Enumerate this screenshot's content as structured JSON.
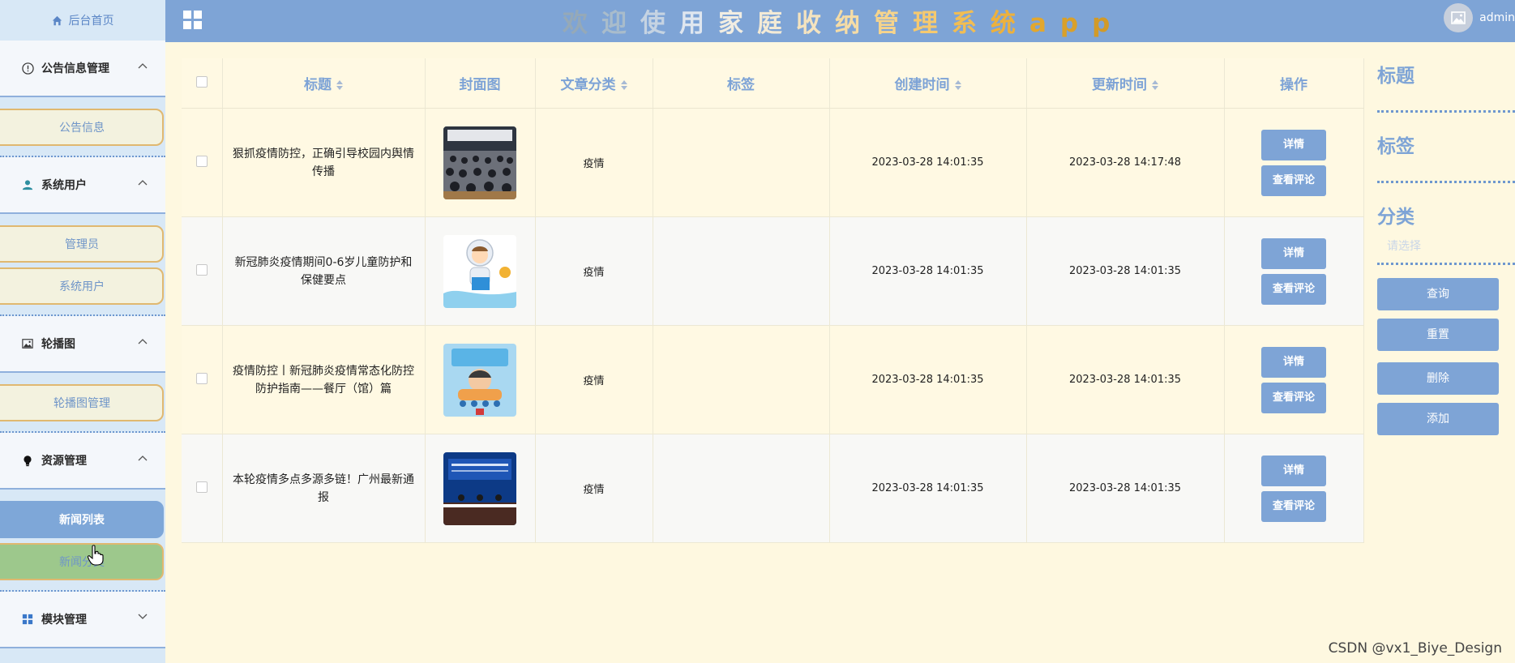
{
  "header": {
    "title_chars": [
      {
        "ch": "欢",
        "color": "#95a9b8"
      },
      {
        "ch": "迎",
        "color": "#a9bccb"
      },
      {
        "ch": "使",
        "color": "#c5d3e2"
      },
      {
        "ch": "用",
        "color": "#dfe6ef"
      },
      {
        "ch": "家",
        "color": "#f1ede2"
      },
      {
        "ch": "庭",
        "color": "#f3ead6"
      },
      {
        "ch": "收",
        "color": "#f4e3bf"
      },
      {
        "ch": "纳",
        "color": "#f5dca6"
      },
      {
        "ch": "管",
        "color": "#f6d48c"
      },
      {
        "ch": "理",
        "color": "#f5c96f"
      },
      {
        "ch": "系",
        "color": "#f2bd52"
      },
      {
        "ch": "统",
        "color": "#edb13c"
      },
      {
        "ch": "a",
        "color": "#e2a72e"
      },
      {
        "ch": "p",
        "color": "#d9a02a"
      },
      {
        "ch": "p",
        "color": "#d29a28"
      }
    ],
    "user_name": "admin"
  },
  "sidebar": {
    "home": "后台首页",
    "groups": [
      {
        "label": "公告信息管理",
        "icon": "info-icon",
        "items": [
          "公告信息"
        ]
      },
      {
        "label": "系统用户",
        "icon": "user-icon",
        "items": [
          "管理员",
          "系统用户"
        ]
      },
      {
        "label": "轮播图",
        "icon": "picture-icon",
        "items": [
          "轮播图管理"
        ]
      },
      {
        "label": "资源管理",
        "icon": "bulb-icon",
        "items": [
          "新闻列表",
          "新闻分类列表"
        ]
      },
      {
        "label": "模块管理",
        "icon": "grid-icon",
        "items": []
      }
    ],
    "hover_item_text": "新闻分类"
  },
  "table": {
    "headers": [
      "标题",
      "封面图",
      "文章分类",
      "标签",
      "创建时间",
      "更新时间",
      "操作"
    ],
    "rows": [
      {
        "title": "狠抓疫情防控，正确引导校园内舆情传播",
        "category": "疫情",
        "tags": "",
        "created": "2023-03-28 14:01:35",
        "updated": "2023-03-28 14:17:48"
      },
      {
        "title": "新冠肺炎疫情期间0-6岁儿童防护和保健要点",
        "category": "疫情",
        "tags": "",
        "created": "2023-03-28 14:01:35",
        "updated": "2023-03-28 14:01:35"
      },
      {
        "title": "疫情防控丨新冠肺炎疫情常态化防控防护指南——餐厅（馆）篇",
        "category": "疫情",
        "tags": "",
        "created": "2023-03-28 14:01:35",
        "updated": "2023-03-28 14:01:35"
      },
      {
        "title": "本轮疫情多点多源多链！广州最新通报",
        "category": "疫情",
        "tags": "",
        "created": "2023-03-28 14:01:35",
        "updated": "2023-03-28 14:01:35"
      }
    ],
    "detail_label": "详情",
    "comment_label": "查看评论"
  },
  "filters": {
    "title_label": "标题",
    "tag_label": "标签",
    "category_label": "分类",
    "category_placeholder": "请选择",
    "query": "查询",
    "reset": "重置",
    "delete": "删除",
    "add": "添加"
  },
  "watermark": "CSDN @vx1_Biye_Design"
}
